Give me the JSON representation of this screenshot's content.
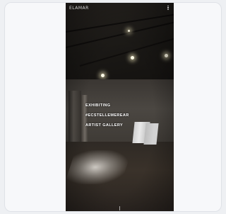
{
  "story": {
    "brand": "ELAMAR",
    "overlay_lines": [
      "EXHIBITING",
      "#ECSTELLEMEREAR",
      "ARTIST GALLERY"
    ]
  },
  "icons": {
    "more": "more-vertical-icon"
  },
  "colors": {
    "page_bg": "#eef0f3",
    "card_bg": "#f7f8fa",
    "photo_dark": "#1a1816"
  }
}
